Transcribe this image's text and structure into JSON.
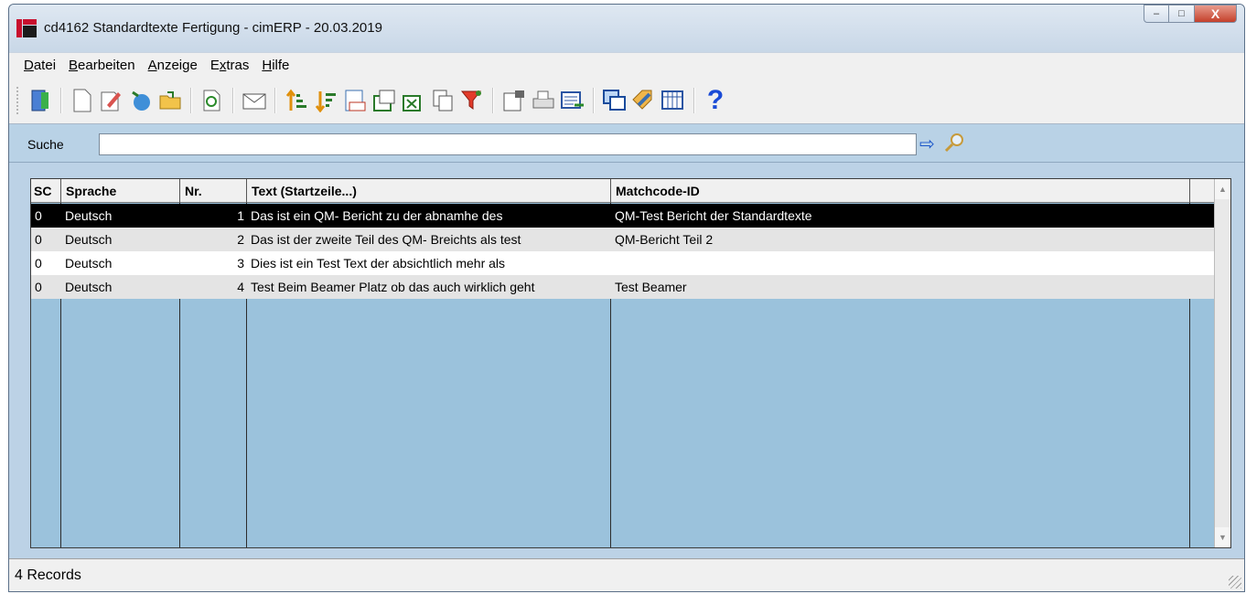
{
  "window": {
    "title": "cd4162 Standardtexte Fertigung - cimERP - 20.03.2019",
    "controls": {
      "minimize": "–",
      "maximize": "□",
      "close": "X"
    }
  },
  "menu": [
    {
      "underlined": "D",
      "rest": "atei"
    },
    {
      "underlined": "B",
      "rest": "earbeiten"
    },
    {
      "underlined": "A",
      "rest": "nzeige"
    },
    {
      "pre": "E",
      "underlined": "x",
      "rest": "tras"
    },
    {
      "underlined": "H",
      "rest": "ilfe"
    }
  ],
  "toolbar_icons": [
    "exit-icon",
    "new-document-icon",
    "edit-icon",
    "copy-record-icon",
    "open-folder-icon",
    "refresh-icon",
    "mail-icon",
    "sort-ascending-icon",
    "sort-descending-icon",
    "number-list-icon",
    "export-icon",
    "excel-icon",
    "copy-icon",
    "filter-icon",
    "properties-icon",
    "print-icon",
    "form-icon",
    "windows-icon",
    "tag-icon",
    "grid-icon",
    "help-icon"
  ],
  "search": {
    "label": "Suche",
    "value": ""
  },
  "table": {
    "headers": [
      "SC",
      "Sprache",
      "Nr.",
      "Text (Startzeile...)",
      "Matchcode-ID"
    ],
    "rows": [
      {
        "sc": "0",
        "sprache": "Deutsch",
        "nr": "1",
        "text": "Das ist ein QM- Bericht zu der abnamhe des",
        "matchcode": "QM-Test Bericht der Standardtexte",
        "selected": true
      },
      {
        "sc": "0",
        "sprache": "Deutsch",
        "nr": "2",
        "text": "Das ist der zweite Teil des QM- Breichts als test",
        "matchcode": "QM-Bericht Teil 2"
      },
      {
        "sc": "0",
        "sprache": "Deutsch",
        "nr": "3",
        "text": "Dies ist ein Test Text der absichtlich mehr als",
        "matchcode": ""
      },
      {
        "sc": "0",
        "sprache": "Deutsch",
        "nr": "4",
        "text": "Test Beim Beamer Platz ob das auch wirklich geht",
        "matchcode": "Test Beamer"
      }
    ]
  },
  "status": {
    "text": "4 Records"
  }
}
